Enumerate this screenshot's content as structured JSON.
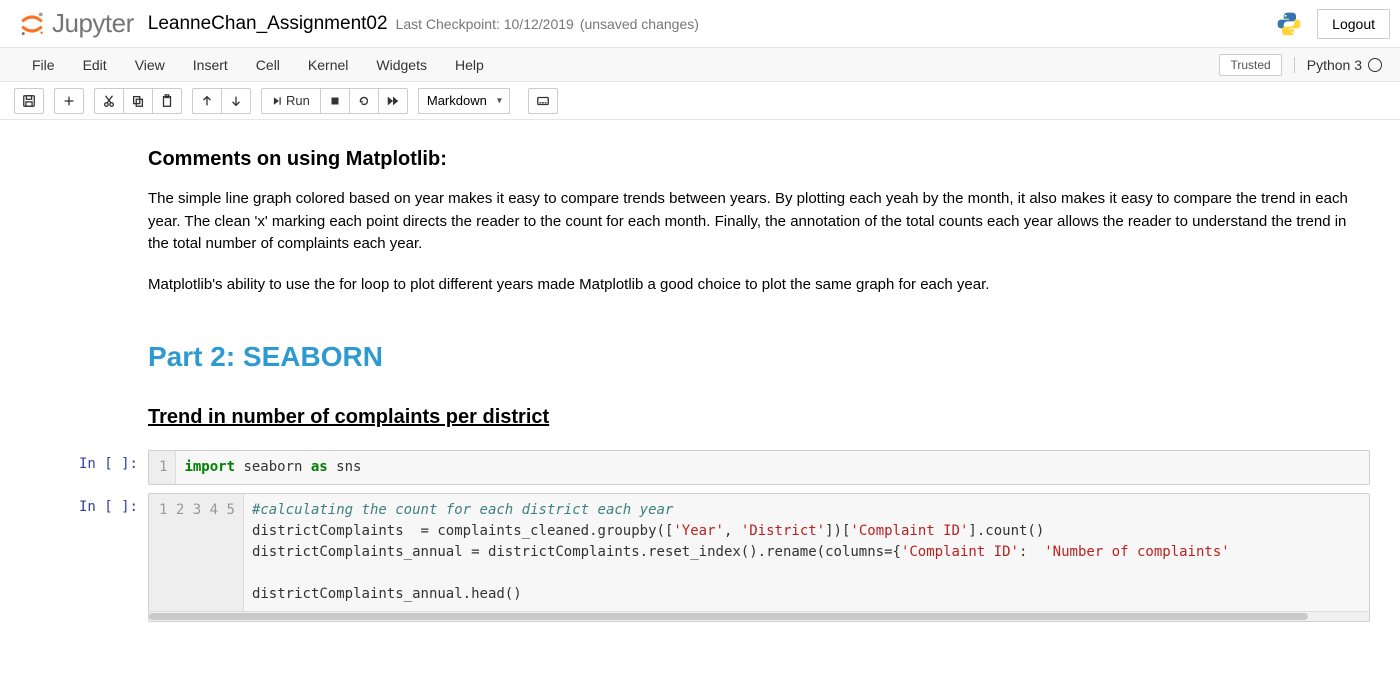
{
  "header": {
    "logo_text": "Jupyter",
    "notebook_title": "LeanneChan_Assignment02",
    "checkpoint": "Last Checkpoint: 10/12/2019",
    "unsaved": "(unsaved changes)",
    "logout": "Logout"
  },
  "menubar": {
    "items": [
      "File",
      "Edit",
      "View",
      "Insert",
      "Cell",
      "Kernel",
      "Widgets",
      "Help"
    ],
    "trusted": "Trusted",
    "kernel": "Python 3"
  },
  "toolbar": {
    "run": "Run",
    "celltype": "Markdown"
  },
  "cells": {
    "md_h3": "Comments on using Matplotlib:",
    "md_p1": "The simple line graph colored based on year makes it easy to compare trends between years. By plotting each yeah by the month, it also makes it easy to compare the trend in each year. The clean 'x' marking each point directs the reader to the count for each month. Finally, the annotation of the total counts each year allows the reader to understand the trend in the total number of complaints each year.",
    "md_p2": "Matplotlib's ability to use the for loop to plot different years made Matplotlib a good choice to plot the same graph for each year.",
    "md_h1": "Part 2: SEABORN",
    "md_h3b": "Trend in number of complaints per district",
    "prompt1": "In [ ]:",
    "prompt2": "In [ ]:",
    "code1": {
      "gutter": "1",
      "tokens": {
        "import": "import",
        "seaborn": " seaborn ",
        "as": "as",
        "sns": " sns"
      }
    },
    "code2": {
      "gutter": [
        "1",
        "2",
        "3",
        "4",
        "5"
      ],
      "l1": "#calculating the count for each district each year",
      "l2a": "districtComplaints  = complaints_cleaned.groupby([",
      "l2s1": "'Year'",
      "l2b": ", ",
      "l2s2": "'District'",
      "l2c": "])[",
      "l2s3": "'Complaint ID'",
      "l2d": "].count()",
      "l3a": "districtComplaints_annual = districtComplaints.reset_index().rename(columns={",
      "l3s1": "'Complaint ID'",
      "l3b": ": ",
      "l3s2": " 'Number of complaints'",
      "l5": "districtComplaints_annual.head()"
    }
  }
}
